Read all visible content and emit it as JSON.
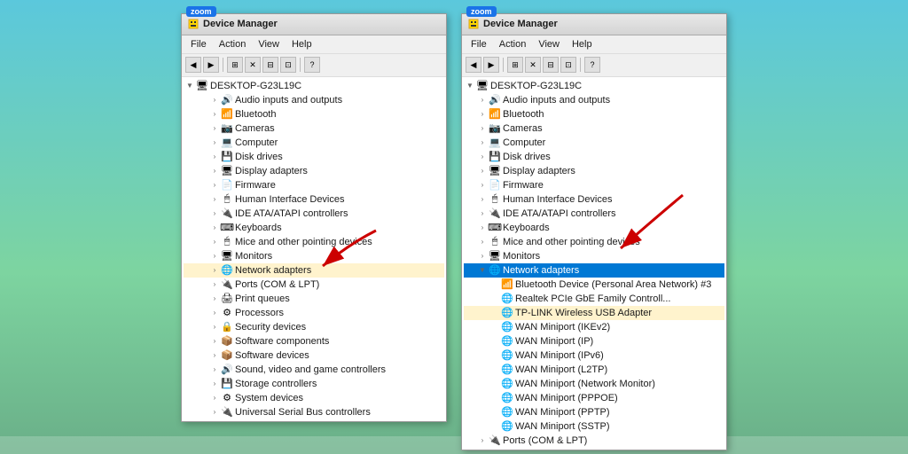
{
  "background": {
    "color_top": "#5BC8DC",
    "color_bottom": "#6AAF88"
  },
  "left_window": {
    "title": "Device Manager",
    "zoom_label": "zoom",
    "menu": [
      "File",
      "Action",
      "View",
      "Help"
    ],
    "tree_root": "DESKTOP-G23L19C",
    "items": [
      {
        "label": "Audio inputs and outputs",
        "icon": "🔊",
        "indent": 1,
        "expanded": false
      },
      {
        "label": "Bluetooth",
        "icon": "📡",
        "indent": 1,
        "expanded": false
      },
      {
        "label": "Cameras",
        "icon": "📷",
        "indent": 1,
        "expanded": false
      },
      {
        "label": "Computer",
        "icon": "💻",
        "indent": 1,
        "expanded": false
      },
      {
        "label": "Disk drives",
        "icon": "💾",
        "indent": 1,
        "expanded": false
      },
      {
        "label": "Display adapters",
        "icon": "🖥",
        "indent": 1,
        "expanded": false
      },
      {
        "label": "Firmware",
        "icon": "📄",
        "indent": 1,
        "expanded": false
      },
      {
        "label": "Human Interface Devices",
        "icon": "🖱",
        "indent": 1,
        "expanded": false
      },
      {
        "label": "IDE ATA/ATAPI controllers",
        "icon": "🔌",
        "indent": 1,
        "expanded": false
      },
      {
        "label": "Keyboards",
        "icon": "⌨",
        "indent": 1,
        "expanded": false
      },
      {
        "label": "Mice and other pointing devices",
        "icon": "🖱",
        "indent": 1,
        "expanded": false
      },
      {
        "label": "Monitors",
        "icon": "🖥",
        "indent": 1,
        "expanded": false
      },
      {
        "label": "Network adapters",
        "icon": "🌐",
        "indent": 1,
        "expanded": false,
        "highlighted": true
      },
      {
        "label": "Ports (COM & LPT)",
        "icon": "🔌",
        "indent": 1,
        "expanded": false
      },
      {
        "label": "Print queues",
        "icon": "🖨",
        "indent": 1,
        "expanded": false
      },
      {
        "label": "Processors",
        "icon": "⚙",
        "indent": 1,
        "expanded": false
      },
      {
        "label": "Security devices",
        "icon": "🔒",
        "indent": 1,
        "expanded": false
      },
      {
        "label": "Software components",
        "icon": "📦",
        "indent": 1,
        "expanded": false
      },
      {
        "label": "Software devices",
        "icon": "📦",
        "indent": 1,
        "expanded": false
      },
      {
        "label": "Sound, video and game controllers",
        "icon": "🔊",
        "indent": 1,
        "expanded": false
      },
      {
        "label": "Storage controllers",
        "icon": "💾",
        "indent": 1,
        "expanded": false
      },
      {
        "label": "System devices",
        "icon": "⚙",
        "indent": 1,
        "expanded": false
      },
      {
        "label": "Universal Serial Bus controllers",
        "icon": "🔌",
        "indent": 1,
        "expanded": false
      }
    ]
  },
  "right_window": {
    "title": "Device Manager",
    "zoom_label": "zoom",
    "menu": [
      "File",
      "Action",
      "View",
      "Help"
    ],
    "tree_root": "DESKTOP-G23L19C",
    "items": [
      {
        "label": "Audio inputs and outputs",
        "icon": "🔊",
        "indent": 1,
        "expanded": false
      },
      {
        "label": "Bluetooth",
        "icon": "📡",
        "indent": 1,
        "expanded": false
      },
      {
        "label": "Cameras",
        "icon": "📷",
        "indent": 1,
        "expanded": false
      },
      {
        "label": "Computer",
        "icon": "💻",
        "indent": 1,
        "expanded": false
      },
      {
        "label": "Disk drives",
        "icon": "💾",
        "indent": 1,
        "expanded": false
      },
      {
        "label": "Display adapters",
        "icon": "🖥",
        "indent": 1,
        "expanded": false
      },
      {
        "label": "Firmware",
        "icon": "📄",
        "indent": 1,
        "expanded": false
      },
      {
        "label": "Human Interface Devices",
        "icon": "🖱",
        "indent": 1,
        "expanded": false
      },
      {
        "label": "IDE ATA/ATAPI controllers",
        "icon": "🔌",
        "indent": 1,
        "expanded": false
      },
      {
        "label": "Keyboards",
        "icon": "⌨",
        "indent": 1,
        "expanded": false
      },
      {
        "label": "Mice and other pointing devices",
        "icon": "🖱",
        "indent": 1,
        "expanded": false
      },
      {
        "label": "Monitors",
        "icon": "🖥",
        "indent": 1,
        "expanded": false
      },
      {
        "label": "Network adapters",
        "icon": "🌐",
        "indent": 1,
        "expanded": true,
        "selected": true
      },
      {
        "label": "Bluetooth Device (Personal Area Network) #3",
        "icon": "📡",
        "indent": 2,
        "expanded": false
      },
      {
        "label": "Realtek PCIe GbE Family Controll...",
        "icon": "🌐",
        "indent": 2,
        "expanded": false
      },
      {
        "label": "TP-LINK Wireless USB Adapter",
        "icon": "🌐",
        "indent": 2,
        "expanded": false,
        "highlighted": true
      },
      {
        "label": "WAN Miniport (IKEv2)",
        "icon": "🌐",
        "indent": 2,
        "expanded": false
      },
      {
        "label": "WAN Miniport (IP)",
        "icon": "🌐",
        "indent": 2,
        "expanded": false
      },
      {
        "label": "WAN Miniport (IPv6)",
        "icon": "🌐",
        "indent": 2,
        "expanded": false
      },
      {
        "label": "WAN Miniport (L2TP)",
        "icon": "🌐",
        "indent": 2,
        "expanded": false
      },
      {
        "label": "WAN Miniport (Network Monitor)",
        "icon": "🌐",
        "indent": 2,
        "expanded": false
      },
      {
        "label": "WAN Miniport (PPPOE)",
        "icon": "🌐",
        "indent": 2,
        "expanded": false
      },
      {
        "label": "WAN Miniport (PPTP)",
        "icon": "🌐",
        "indent": 2,
        "expanded": false
      },
      {
        "label": "WAN Miniport (SSTP)",
        "icon": "🌐",
        "indent": 2,
        "expanded": false
      },
      {
        "label": "Ports (COM & LPT)",
        "icon": "🔌",
        "indent": 1,
        "expanded": false
      }
    ]
  }
}
